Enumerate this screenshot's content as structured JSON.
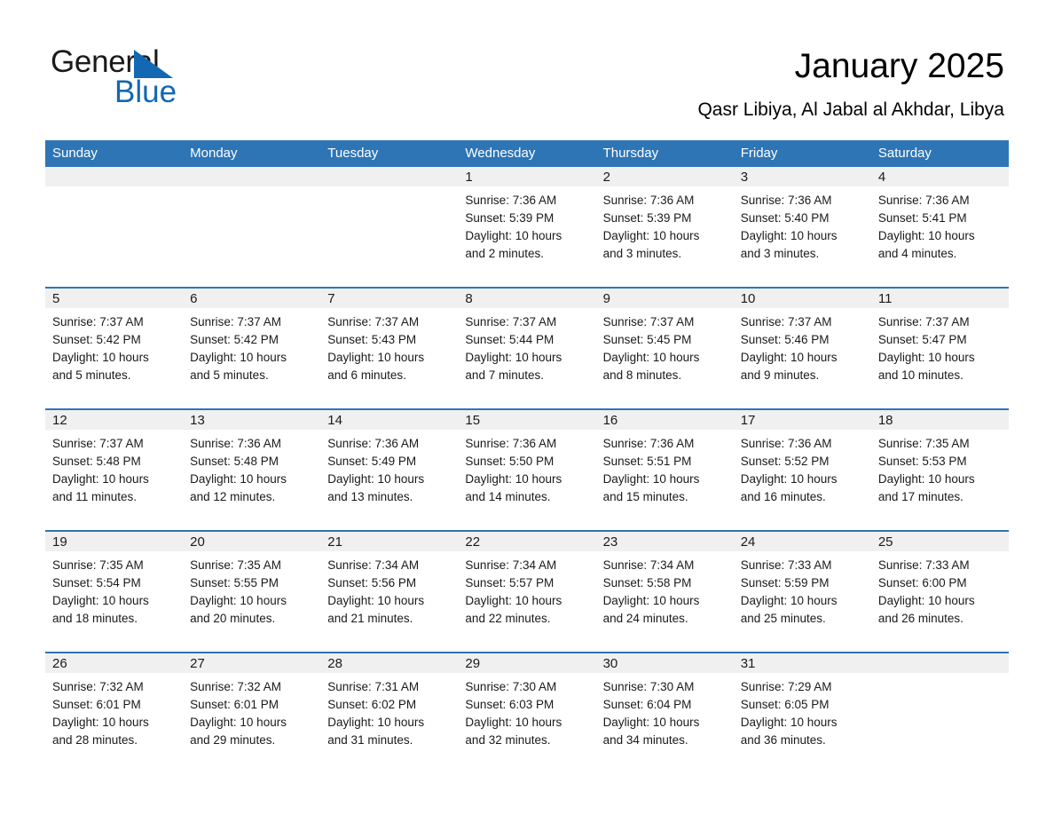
{
  "brand": {
    "name_part1": "General",
    "name_part2": "Blue",
    "triangle_color": "#1268b3",
    "blue_color": "#1268b3"
  },
  "header": {
    "title": "January 2025",
    "subtitle": "Qasr Libiya, Al Jabal al Akhdar, Libya"
  },
  "theme": {
    "header_blue": "#2e75b6",
    "date_strip_gray": "#f0f0f0",
    "text_black": "#1a1a1a",
    "background": "#ffffff"
  },
  "calendar": {
    "weekdays": [
      "Sunday",
      "Monday",
      "Tuesday",
      "Wednesday",
      "Thursday",
      "Friday",
      "Saturday"
    ],
    "weeks": [
      [
        {
          "date": "",
          "sunrise": "",
          "sunset": "",
          "daylight1": "",
          "daylight2": ""
        },
        {
          "date": "",
          "sunrise": "",
          "sunset": "",
          "daylight1": "",
          "daylight2": ""
        },
        {
          "date": "",
          "sunrise": "",
          "sunset": "",
          "daylight1": "",
          "daylight2": ""
        },
        {
          "date": "1",
          "sunrise": "Sunrise: 7:36 AM",
          "sunset": "Sunset: 5:39 PM",
          "daylight1": "Daylight: 10 hours",
          "daylight2": "and 2 minutes."
        },
        {
          "date": "2",
          "sunrise": "Sunrise: 7:36 AM",
          "sunset": "Sunset: 5:39 PM",
          "daylight1": "Daylight: 10 hours",
          "daylight2": "and 3 minutes."
        },
        {
          "date": "3",
          "sunrise": "Sunrise: 7:36 AM",
          "sunset": "Sunset: 5:40 PM",
          "daylight1": "Daylight: 10 hours",
          "daylight2": "and 3 minutes."
        },
        {
          "date": "4",
          "sunrise": "Sunrise: 7:36 AM",
          "sunset": "Sunset: 5:41 PM",
          "daylight1": "Daylight: 10 hours",
          "daylight2": "and 4 minutes."
        }
      ],
      [
        {
          "date": "5",
          "sunrise": "Sunrise: 7:37 AM",
          "sunset": "Sunset: 5:42 PM",
          "daylight1": "Daylight: 10 hours",
          "daylight2": "and 5 minutes."
        },
        {
          "date": "6",
          "sunrise": "Sunrise: 7:37 AM",
          "sunset": "Sunset: 5:42 PM",
          "daylight1": "Daylight: 10 hours",
          "daylight2": "and 5 minutes."
        },
        {
          "date": "7",
          "sunrise": "Sunrise: 7:37 AM",
          "sunset": "Sunset: 5:43 PM",
          "daylight1": "Daylight: 10 hours",
          "daylight2": "and 6 minutes."
        },
        {
          "date": "8",
          "sunrise": "Sunrise: 7:37 AM",
          "sunset": "Sunset: 5:44 PM",
          "daylight1": "Daylight: 10 hours",
          "daylight2": "and 7 minutes."
        },
        {
          "date": "9",
          "sunrise": "Sunrise: 7:37 AM",
          "sunset": "Sunset: 5:45 PM",
          "daylight1": "Daylight: 10 hours",
          "daylight2": "and 8 minutes."
        },
        {
          "date": "10",
          "sunrise": "Sunrise: 7:37 AM",
          "sunset": "Sunset: 5:46 PM",
          "daylight1": "Daylight: 10 hours",
          "daylight2": "and 9 minutes."
        },
        {
          "date": "11",
          "sunrise": "Sunrise: 7:37 AM",
          "sunset": "Sunset: 5:47 PM",
          "daylight1": "Daylight: 10 hours",
          "daylight2": "and 10 minutes."
        }
      ],
      [
        {
          "date": "12",
          "sunrise": "Sunrise: 7:37 AM",
          "sunset": "Sunset: 5:48 PM",
          "daylight1": "Daylight: 10 hours",
          "daylight2": "and 11 minutes."
        },
        {
          "date": "13",
          "sunrise": "Sunrise: 7:36 AM",
          "sunset": "Sunset: 5:48 PM",
          "daylight1": "Daylight: 10 hours",
          "daylight2": "and 12 minutes."
        },
        {
          "date": "14",
          "sunrise": "Sunrise: 7:36 AM",
          "sunset": "Sunset: 5:49 PM",
          "daylight1": "Daylight: 10 hours",
          "daylight2": "and 13 minutes."
        },
        {
          "date": "15",
          "sunrise": "Sunrise: 7:36 AM",
          "sunset": "Sunset: 5:50 PM",
          "daylight1": "Daylight: 10 hours",
          "daylight2": "and 14 minutes."
        },
        {
          "date": "16",
          "sunrise": "Sunrise: 7:36 AM",
          "sunset": "Sunset: 5:51 PM",
          "daylight1": "Daylight: 10 hours",
          "daylight2": "and 15 minutes."
        },
        {
          "date": "17",
          "sunrise": "Sunrise: 7:36 AM",
          "sunset": "Sunset: 5:52 PM",
          "daylight1": "Daylight: 10 hours",
          "daylight2": "and 16 minutes."
        },
        {
          "date": "18",
          "sunrise": "Sunrise: 7:35 AM",
          "sunset": "Sunset: 5:53 PM",
          "daylight1": "Daylight: 10 hours",
          "daylight2": "and 17 minutes."
        }
      ],
      [
        {
          "date": "19",
          "sunrise": "Sunrise: 7:35 AM",
          "sunset": "Sunset: 5:54 PM",
          "daylight1": "Daylight: 10 hours",
          "daylight2": "and 18 minutes."
        },
        {
          "date": "20",
          "sunrise": "Sunrise: 7:35 AM",
          "sunset": "Sunset: 5:55 PM",
          "daylight1": "Daylight: 10 hours",
          "daylight2": "and 20 minutes."
        },
        {
          "date": "21",
          "sunrise": "Sunrise: 7:34 AM",
          "sunset": "Sunset: 5:56 PM",
          "daylight1": "Daylight: 10 hours",
          "daylight2": "and 21 minutes."
        },
        {
          "date": "22",
          "sunrise": "Sunrise: 7:34 AM",
          "sunset": "Sunset: 5:57 PM",
          "daylight1": "Daylight: 10 hours",
          "daylight2": "and 22 minutes."
        },
        {
          "date": "23",
          "sunrise": "Sunrise: 7:34 AM",
          "sunset": "Sunset: 5:58 PM",
          "daylight1": "Daylight: 10 hours",
          "daylight2": "and 24 minutes."
        },
        {
          "date": "24",
          "sunrise": "Sunrise: 7:33 AM",
          "sunset": "Sunset: 5:59 PM",
          "daylight1": "Daylight: 10 hours",
          "daylight2": "and 25 minutes."
        },
        {
          "date": "25",
          "sunrise": "Sunrise: 7:33 AM",
          "sunset": "Sunset: 6:00 PM",
          "daylight1": "Daylight: 10 hours",
          "daylight2": "and 26 minutes."
        }
      ],
      [
        {
          "date": "26",
          "sunrise": "Sunrise: 7:32 AM",
          "sunset": "Sunset: 6:01 PM",
          "daylight1": "Daylight: 10 hours",
          "daylight2": "and 28 minutes."
        },
        {
          "date": "27",
          "sunrise": "Sunrise: 7:32 AM",
          "sunset": "Sunset: 6:01 PM",
          "daylight1": "Daylight: 10 hours",
          "daylight2": "and 29 minutes."
        },
        {
          "date": "28",
          "sunrise": "Sunrise: 7:31 AM",
          "sunset": "Sunset: 6:02 PM",
          "daylight1": "Daylight: 10 hours",
          "daylight2": "and 31 minutes."
        },
        {
          "date": "29",
          "sunrise": "Sunrise: 7:30 AM",
          "sunset": "Sunset: 6:03 PM",
          "daylight1": "Daylight: 10 hours",
          "daylight2": "and 32 minutes."
        },
        {
          "date": "30",
          "sunrise": "Sunrise: 7:30 AM",
          "sunset": "Sunset: 6:04 PM",
          "daylight1": "Daylight: 10 hours",
          "daylight2": "and 34 minutes."
        },
        {
          "date": "31",
          "sunrise": "Sunrise: 7:29 AM",
          "sunset": "Sunset: 6:05 PM",
          "daylight1": "Daylight: 10 hours",
          "daylight2": "and 36 minutes."
        },
        {
          "date": "",
          "sunrise": "",
          "sunset": "",
          "daylight1": "",
          "daylight2": ""
        }
      ]
    ]
  }
}
